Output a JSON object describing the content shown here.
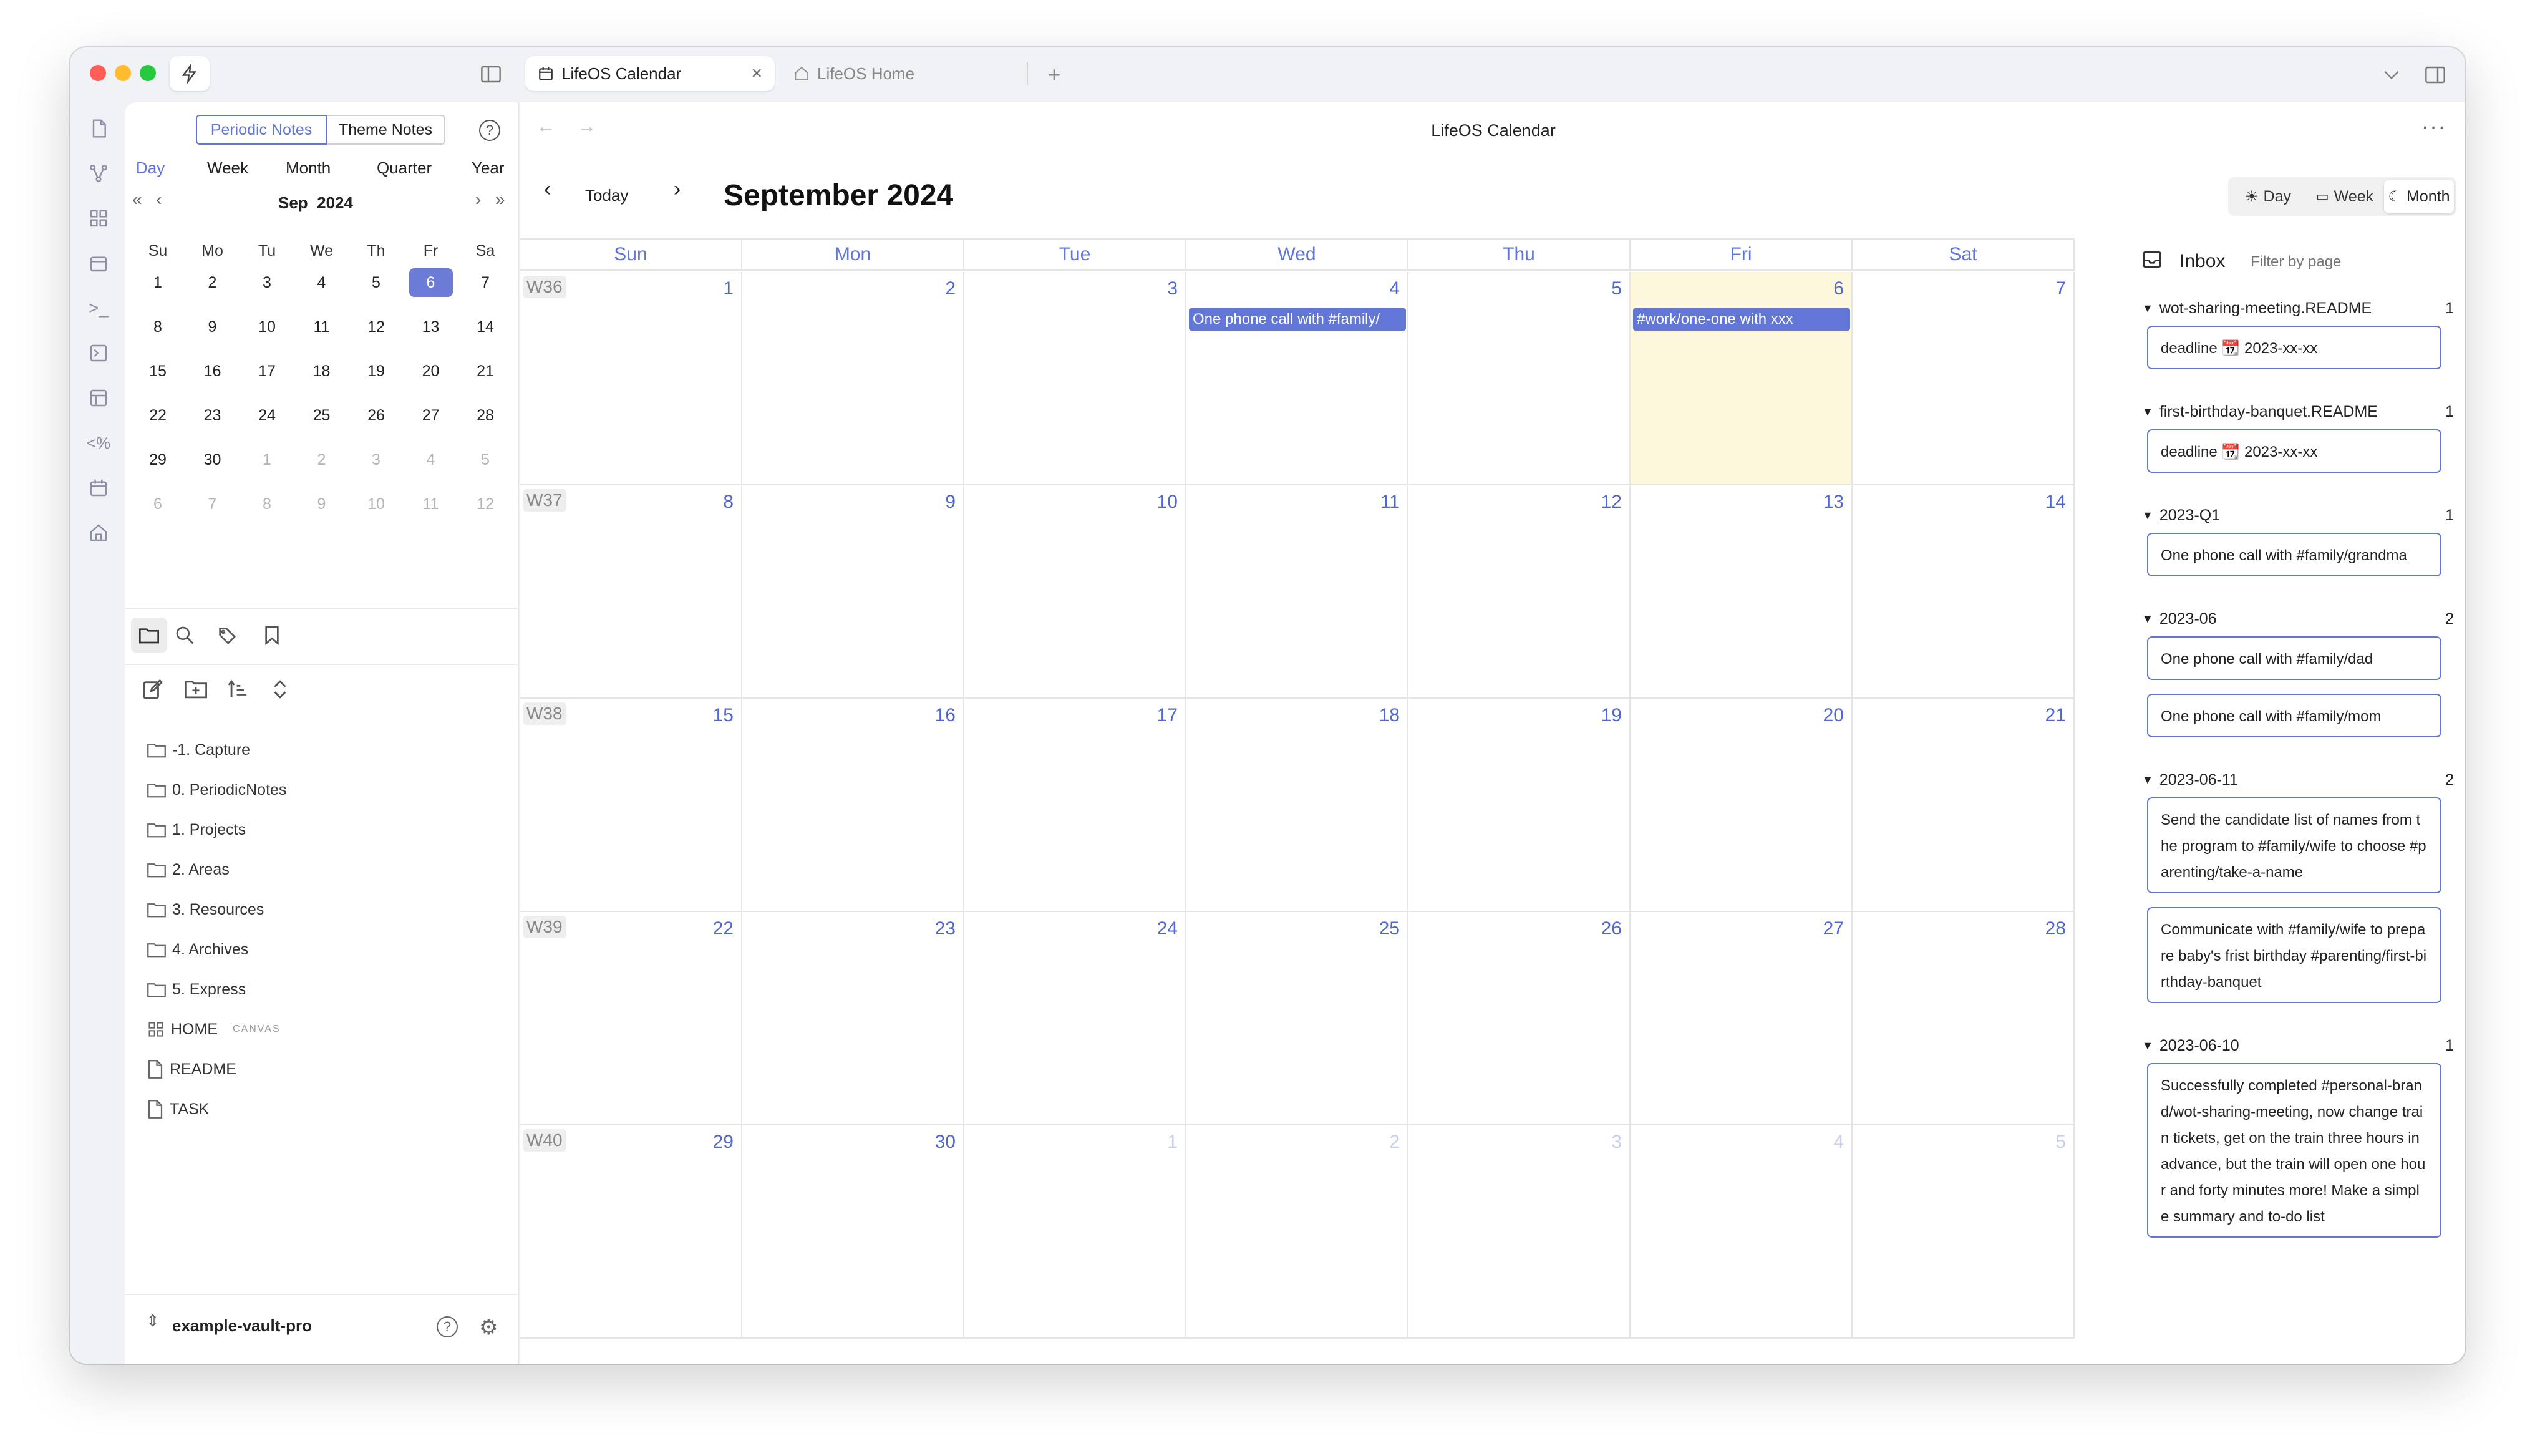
{
  "tabs": [
    {
      "label": "LifeOS Calendar",
      "active": true
    },
    {
      "label": "LifeOS Home",
      "active": false
    }
  ],
  "sidebar": {
    "note_types": [
      "Periodic Notes",
      "Theme Notes"
    ],
    "periods": [
      "Day",
      "Week",
      "Month",
      "Quarter",
      "Year"
    ],
    "month_label": "Sep",
    "year_label": "2024",
    "weekday_heads": [
      "Su",
      "Mo",
      "Tu",
      "We",
      "Th",
      "Fr",
      "Sa"
    ],
    "weeks": [
      [
        "1",
        "2",
        "3",
        "4",
        "5",
        "6",
        "7"
      ],
      [
        "8",
        "9",
        "10",
        "11",
        "12",
        "13",
        "14"
      ],
      [
        "15",
        "16",
        "17",
        "18",
        "19",
        "20",
        "21"
      ],
      [
        "22",
        "23",
        "24",
        "25",
        "26",
        "27",
        "28"
      ],
      [
        "29",
        "30",
        "1",
        "2",
        "3",
        "4",
        "5"
      ],
      [
        "6",
        "7",
        "8",
        "9",
        "10",
        "11",
        "12"
      ]
    ],
    "selected_day": "6",
    "files": [
      {
        "label": "-1. Capture",
        "icon": "folder-icon"
      },
      {
        "label": "0. PeriodicNotes",
        "icon": "folder-icon"
      },
      {
        "label": "1. Projects",
        "icon": "folder-icon"
      },
      {
        "label": "2. Areas",
        "icon": "folder-icon"
      },
      {
        "label": "3. Resources",
        "icon": "folder-icon"
      },
      {
        "label": "4. Archives",
        "icon": "folder-icon"
      },
      {
        "label": "5. Express",
        "icon": "folder-icon"
      },
      {
        "label": "HOME",
        "icon": "canvas-icon",
        "badge": "CANVAS"
      },
      {
        "label": "README",
        "icon": "file-icon"
      },
      {
        "label": "TASK",
        "icon": "file-icon"
      }
    ],
    "vault_name": "example-vault-pro"
  },
  "main": {
    "view_title": "LifeOS Calendar",
    "today_label": "Today",
    "month_title": "September 2024",
    "view_modes": [
      "Day",
      "Week",
      "Month"
    ],
    "active_view": "Month",
    "day_headers": [
      "Sun",
      "Mon",
      "Tue",
      "Wed",
      "Thu",
      "Fri",
      "Sat"
    ],
    "weeks": [
      {
        "label": "W36",
        "days": [
          "1",
          "2",
          "3",
          "4",
          "5",
          "6",
          "7"
        ]
      },
      {
        "label": "W37",
        "days": [
          "8",
          "9",
          "10",
          "11",
          "12",
          "13",
          "14"
        ]
      },
      {
        "label": "W38",
        "days": [
          "15",
          "16",
          "17",
          "18",
          "19",
          "20",
          "21"
        ]
      },
      {
        "label": "W39",
        "days": [
          "22",
          "23",
          "24",
          "25",
          "26",
          "27",
          "28"
        ]
      },
      {
        "label": "W40",
        "days": [
          "29",
          "30",
          "1",
          "2",
          "3",
          "4",
          "5"
        ]
      }
    ],
    "events": [
      {
        "week": 0,
        "day": 3,
        "text": "One phone call with #family/"
      },
      {
        "week": 0,
        "day": 5,
        "text": "#work/one-one with xxx"
      }
    ]
  },
  "inbox": {
    "title": "Inbox",
    "filter_placeholder": "Filter by page",
    "groups": [
      {
        "title": "wot-sharing-meeting.README",
        "count": "1",
        "items": [
          "deadline 📆 2023-xx-xx"
        ]
      },
      {
        "title": "first-birthday-banquet.README",
        "count": "1",
        "items": [
          "deadline 📆 2023-xx-xx"
        ]
      },
      {
        "title": "2023-Q1",
        "count": "1",
        "items": [
          "One phone call with #family/grandma"
        ]
      },
      {
        "title": "2023-06",
        "count": "2",
        "items": [
          "One phone call with #family/dad",
          "One phone call with #family/mom"
        ]
      },
      {
        "title": "2023-06-11",
        "count": "2",
        "items": [
          "Send the candidate list of names from the program to #family/wife to choose #parenting/take-a-name",
          "Communicate with #family/wife to prepare baby's frist birthday #parenting/first-birthday-banquet"
        ]
      },
      {
        "title": "2023-06-10",
        "count": "1",
        "items": [
          "Successfully completed #personal-brand/wot-sharing-meeting, now change train tickets, get on the train three hours in advance, but the train will open one hour and forty minutes more! Make a simple summary and to-do list"
        ]
      }
    ]
  },
  "colors": {
    "accent": "#6176d6",
    "today_bg": "#fdf8dc"
  }
}
